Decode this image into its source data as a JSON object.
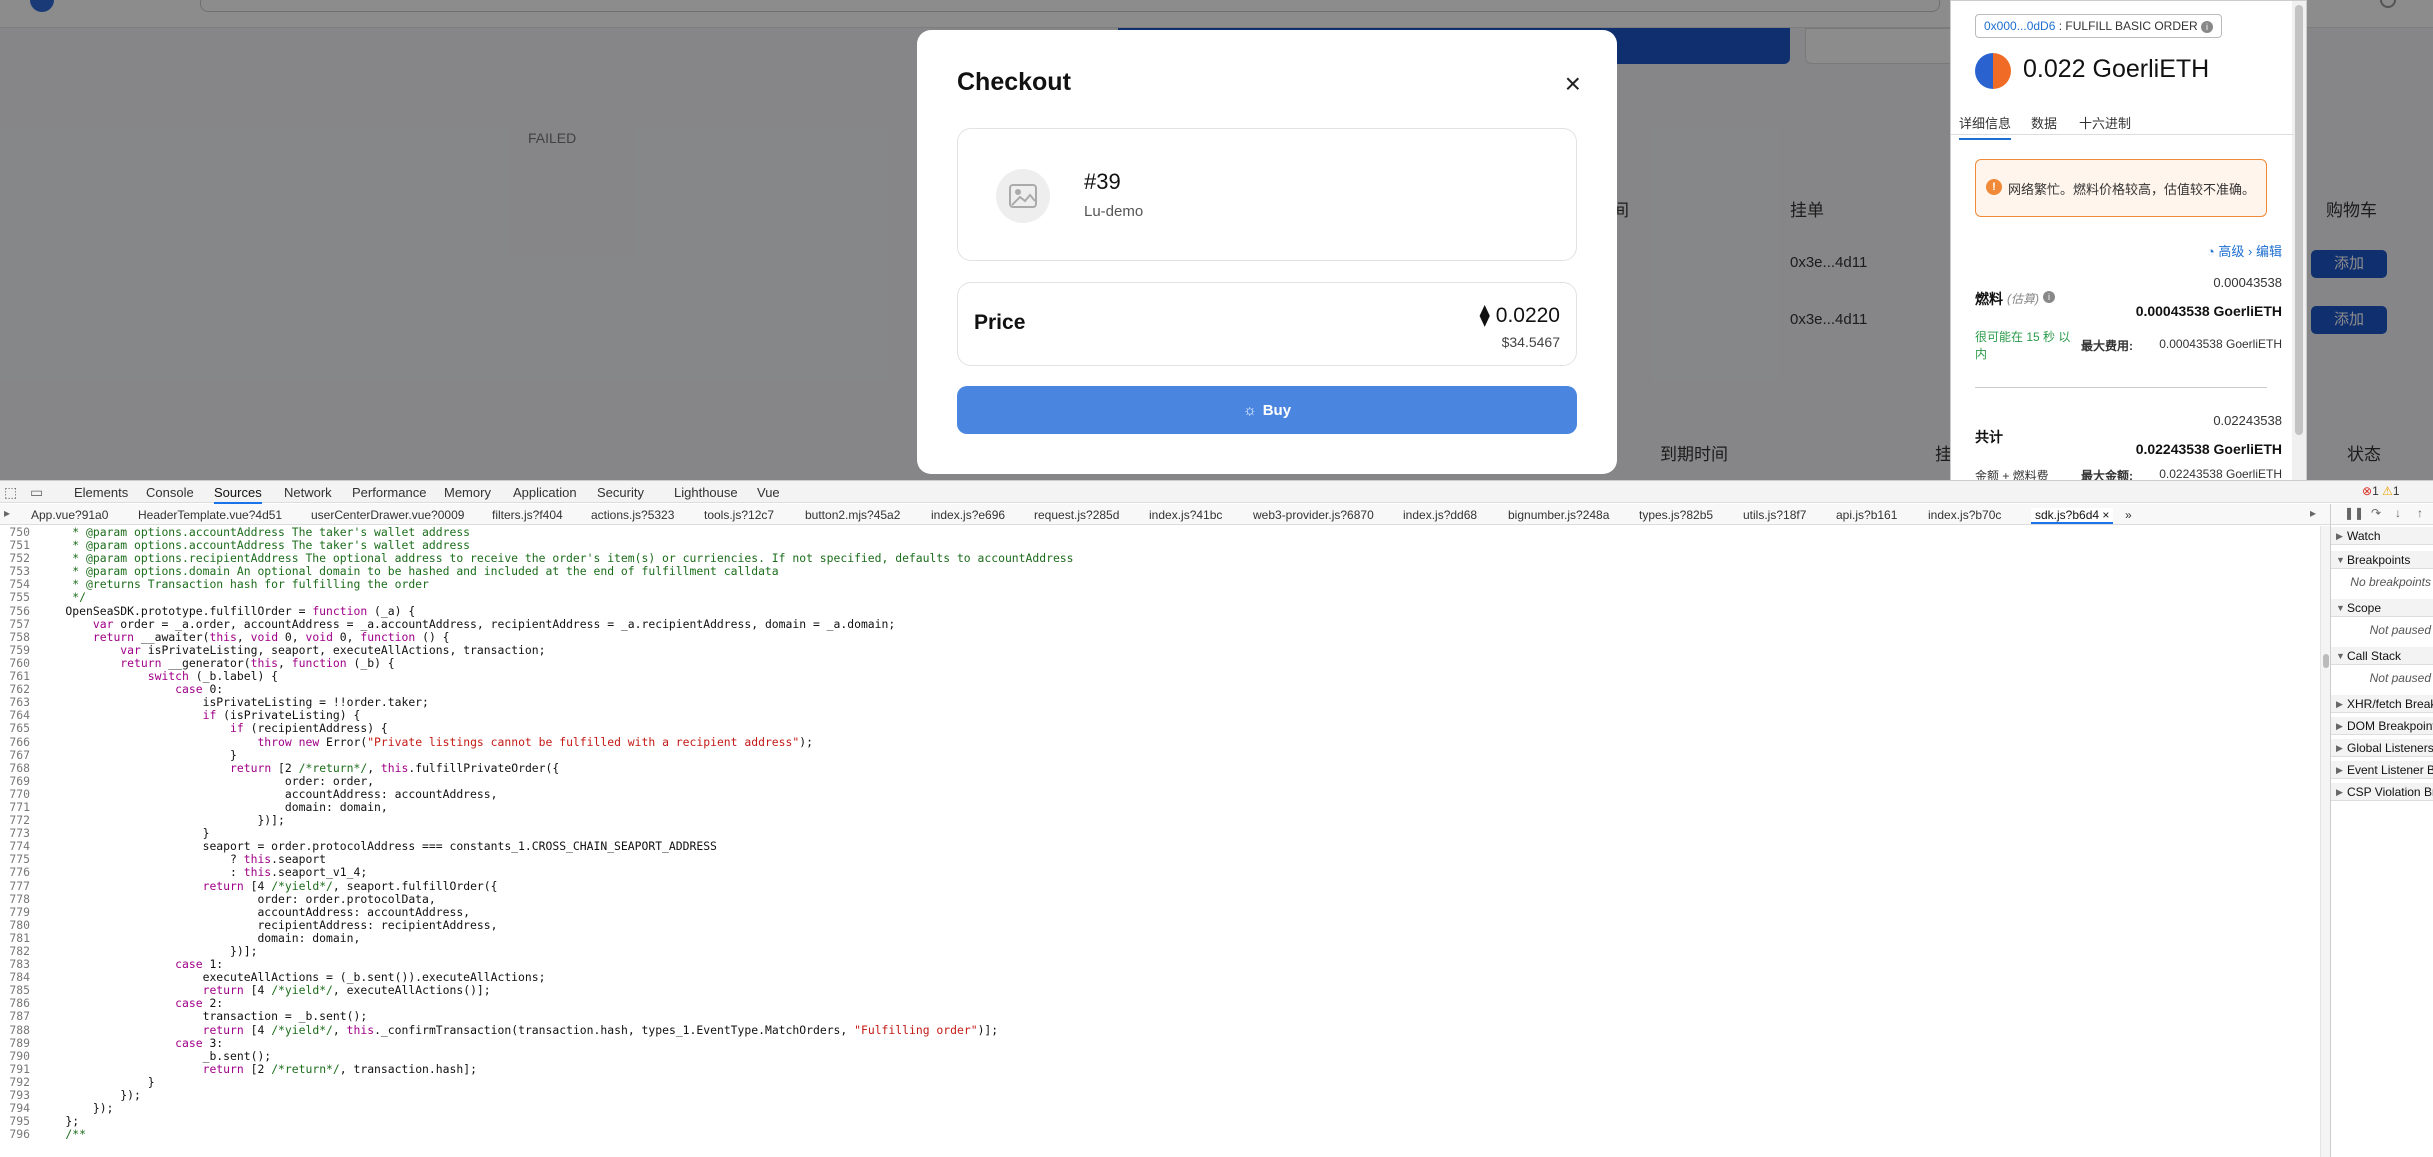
{
  "app": {
    "failed": "FAILED",
    "col_listing": "挂单",
    "col_cart": "购物车",
    "col_time_partial": "间",
    "col_expiry": "到期时间",
    "col_listing_partial": "挂",
    "col_status": "状态",
    "row_addr_1": "0x3e...4d11",
    "row_addr_2": "0x3e...4d11",
    "add_label_1": "添加",
    "add_label_2": "添加"
  },
  "modal": {
    "title": "Checkout",
    "close_glyph": "×",
    "item_number": "#39",
    "item_collection": "Lu-demo",
    "price_label": "Price",
    "price_eth": "⧫ 0.0220",
    "price_usd": "$34.5467",
    "buy_label": "Buy"
  },
  "metamask": {
    "chip_address": "0x000...0dD6",
    "chip_label": ": FULFILL BASIC ORDER",
    "amount": "0.022 GoerliETH",
    "tabs": [
      "详细信息",
      "数据",
      "十六进制"
    ],
    "warning": "网络繁忙。燃料价格较高，估值较不准确。",
    "advanced": "高级",
    "edit": "编辑",
    "fee_label": "燃料",
    "fee_estimated": "(估算)",
    "fee_value_small": "0.00043538",
    "fee_value_bold": "0.00043538 GoerliETH",
    "likely": "很可能在 15 秒 以内",
    "max_fee_label": "最大费用:",
    "max_fee_value": "0.00043538 GoerliETH",
    "total_label": "共计",
    "total_value_small": "0.02243538",
    "total_value_bold": "0.02243538 GoerliETH",
    "amount_plus_fee": "金额 + 燃料费",
    "max_amount_label": "最大金额:",
    "max_amount_value": "0.02243538 GoerliETH"
  },
  "devtools": {
    "tabs": [
      "Elements",
      "Console",
      "Sources",
      "Network",
      "Performance",
      "Memory",
      "Application",
      "Security",
      "Lighthouse",
      "Vue"
    ],
    "active_tab": "Sources",
    "error_count": "1",
    "warning_count": "1",
    "files": [
      "App.vue?91a0",
      "HeaderTemplate.vue?4d51",
      "userCenterDrawer.vue?0009",
      "filters.js?f404",
      "actions.js?5323",
      "tools.js?12c7",
      "button2.mjs?45a2",
      "index.js?e696",
      "request.js?285d",
      "index.js?41bc",
      "web3-provider.js?6870",
      "index.js?dd68",
      "bignumber.js?248a",
      "types.js?82b5",
      "utils.js?18f7",
      "api.js?b161",
      "index.js?b70c",
      "sdk.js?b6d4"
    ],
    "active_file": "sdk.js?b6d4",
    "panes": [
      "Watch",
      "Breakpoints",
      "Scope",
      "Call Stack",
      "XHR/fetch Breakpoints",
      "DOM Breakpoints",
      "Global Listeners",
      "Event Listener Breakpoints",
      "CSP Violation Breakpoints"
    ],
    "pane_bodies": [
      "No breakpoints",
      "Not paused",
      "Not paused"
    ],
    "code_lines": [
      [
        "750",
        "     * @param options.accountAddress The taker's wallet address"
      ],
      [
        "751",
        "     * @param options.accountAddress The taker's wallet address"
      ],
      [
        "752",
        "     * @param options.recipientAddress The optional address to receive the order's item(s) or curriencies. If not specified, defaults to accountAddress"
      ],
      [
        "753",
        "     * @param options.domain An optional domain to be hashed and included at the end of fulfillment calldata"
      ],
      [
        "754",
        "     * @returns Transaction hash for fulfilling the order"
      ],
      [
        "755",
        "     */"
      ],
      [
        "756",
        "    OpenSeaSDK.prototype.fulfillOrder = function (_a) {"
      ],
      [
        "757",
        "        var order = _a.order, accountAddress = _a.accountAddress, recipientAddress = _a.recipientAddress, domain = _a.domain;"
      ],
      [
        "758",
        "        return __awaiter(this, void 0, void 0, function () {"
      ],
      [
        "759",
        "            var isPrivateListing, seaport, executeAllActions, transaction;"
      ],
      [
        "760",
        "            return __generator(this, function (_b) {"
      ],
      [
        "761",
        "                switch (_b.label) {"
      ],
      [
        "762",
        "                    case 0:"
      ],
      [
        "763",
        "                        isPrivateListing = !!order.taker;"
      ],
      [
        "764",
        "                        if (isPrivateListing) {"
      ],
      [
        "765",
        "                            if (recipientAddress) {"
      ],
      [
        "766",
        "                                throw new Error(\"Private listings cannot be fulfilled with a recipient address\");"
      ],
      [
        "767",
        "                            }"
      ],
      [
        "768",
        "                            return [2 /*return*/, this.fulfillPrivateOrder({"
      ],
      [
        "769",
        "                                    order: order,"
      ],
      [
        "770",
        "                                    accountAddress: accountAddress,"
      ],
      [
        "771",
        "                                    domain: domain,"
      ],
      [
        "772",
        "                                })];"
      ],
      [
        "773",
        "                        }"
      ],
      [
        "774",
        "                        seaport = order.protocolAddress === constants_1.CROSS_CHAIN_SEAPORT_ADDRESS"
      ],
      [
        "775",
        "                            ? this.seaport"
      ],
      [
        "776",
        "                            : this.seaport_v1_4;"
      ],
      [
        "777",
        "                        return [4 /*yield*/, seaport.fulfillOrder({"
      ],
      [
        "778",
        "                                order: order.protocolData,"
      ],
      [
        "779",
        "                                accountAddress: accountAddress,"
      ],
      [
        "780",
        "                                recipientAddress: recipientAddress,"
      ],
      [
        "781",
        "                                domain: domain,"
      ],
      [
        "782",
        "                            })];"
      ],
      [
        "783",
        "                    case 1:"
      ],
      [
        "784",
        "                        executeAllActions = (_b.sent()).executeAllActions;"
      ],
      [
        "785",
        "                        return [4 /*yield*/, executeAllActions()];"
      ],
      [
        "786",
        "                    case 2:"
      ],
      [
        "787",
        "                        transaction = _b.sent();"
      ],
      [
        "788",
        "                        return [4 /*yield*/, this._confirmTransaction(transaction.hash, types_1.EventType.MatchOrders, \"Fulfilling order\")];"
      ],
      [
        "789",
        "                    case 3:"
      ],
      [
        "790",
        "                        _b.sent();"
      ],
      [
        "791",
        "                        return [2 /*return*/, transaction.hash];"
      ],
      [
        "792",
        "                }"
      ],
      [
        "793",
        "            });"
      ],
      [
        "794",
        "        });"
      ],
      [
        "795",
        "    };"
      ],
      [
        "796",
        "    /**"
      ]
    ]
  }
}
